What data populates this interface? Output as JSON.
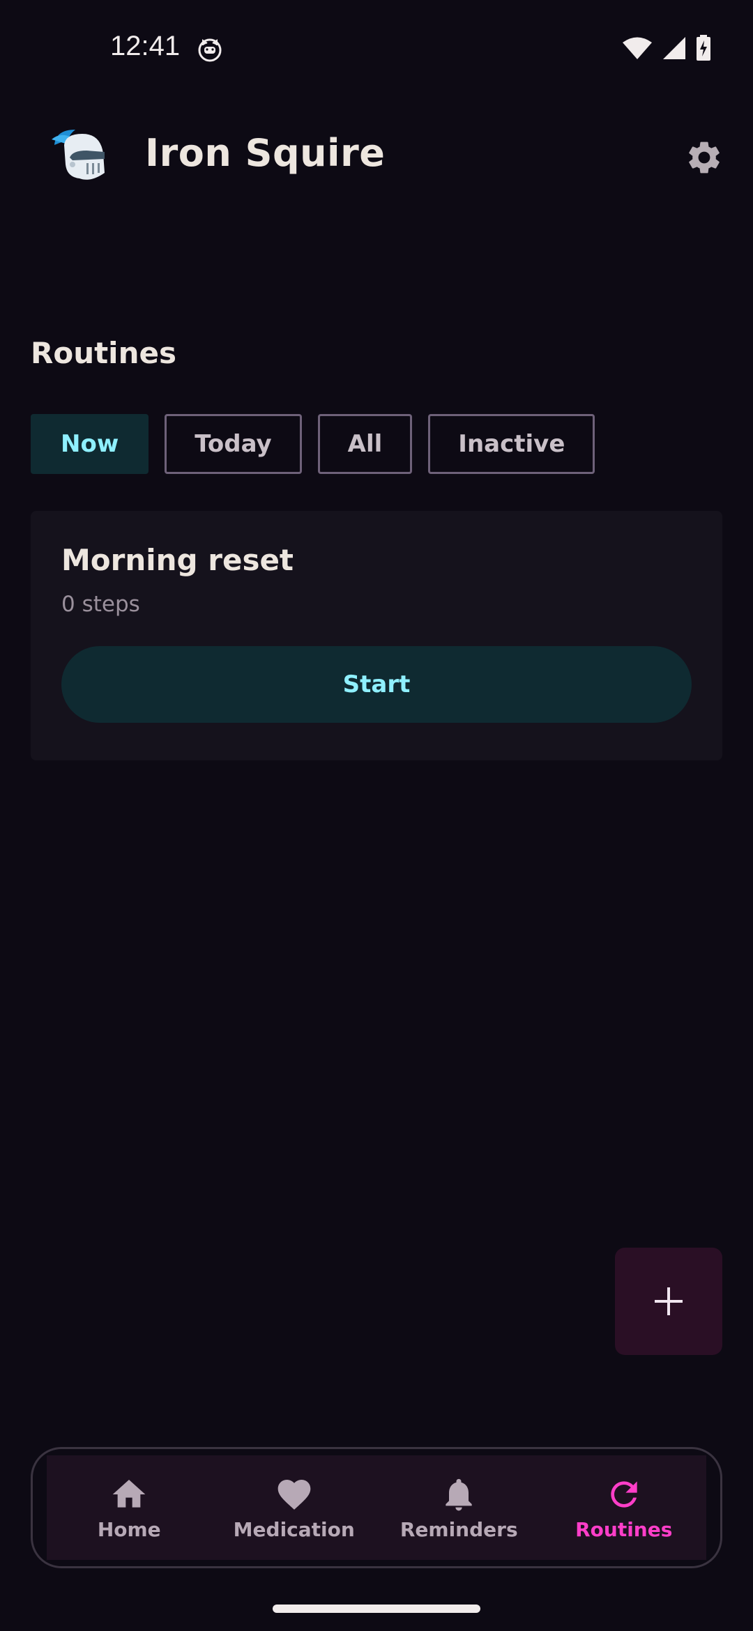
{
  "status_bar": {
    "time": "12:41",
    "notification_icon": "cat-face-icon",
    "icons": [
      "wifi-icon",
      "signal-icon",
      "battery-charging-icon"
    ]
  },
  "app_bar": {
    "title": "Iron Squire",
    "logo_icon": "knight-helmet-icon",
    "settings_icon": "gear-icon"
  },
  "section": {
    "title": "Routines"
  },
  "filters": [
    {
      "label": "Now",
      "active": true
    },
    {
      "label": "Today",
      "active": false
    },
    {
      "label": "All",
      "active": false
    },
    {
      "label": "Inactive",
      "active": false
    }
  ],
  "routine": {
    "name": "Morning reset",
    "steps": "0 steps",
    "start_label": "Start"
  },
  "fab": {
    "icon": "plus-icon"
  },
  "bottom_nav": {
    "items": [
      {
        "label": "Home",
        "icon": "home-icon",
        "active": false
      },
      {
        "label": "Medication",
        "icon": "heart-icon",
        "active": false
      },
      {
        "label": "Reminders",
        "icon": "bell-icon",
        "active": false
      },
      {
        "label": "Routines",
        "icon": "refresh-icon",
        "active": true
      }
    ]
  },
  "colors": {
    "background": "#0d0a14",
    "accent_cyan": "#8ff0ff",
    "accent_pink": "#ff3ec9",
    "card": "#15121c"
  }
}
